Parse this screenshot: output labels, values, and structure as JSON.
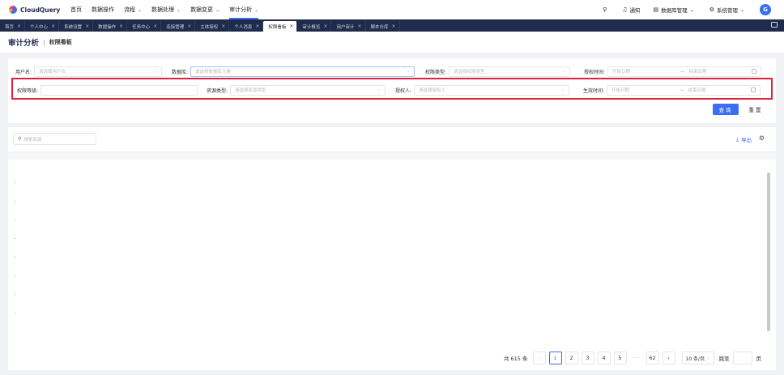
{
  "app": {
    "logo_text": "CloudQuery"
  },
  "nav": [
    {
      "label": "首页",
      "chevron": false,
      "active": false
    },
    {
      "label": "数据操作",
      "chevron": false,
      "active": false
    },
    {
      "label": "流程",
      "chevron": true,
      "active": false
    },
    {
      "label": "数据处理",
      "chevron": true,
      "active": false
    },
    {
      "label": "数据变更",
      "chevron": true,
      "active": false
    },
    {
      "label": "审计分析",
      "chevron": true,
      "active": true
    }
  ],
  "top_right": {
    "search_icon": "search-icon",
    "notify_label": "通知",
    "db_manage_label": "数据库管理",
    "sys_manage_label": "系统管理",
    "avatar_letter": "G"
  },
  "tabs": [
    {
      "label": "首页",
      "active": false
    },
    {
      "label": "个人中心",
      "active": false
    },
    {
      "label": "系统设置",
      "active": false
    },
    {
      "label": "数据操作",
      "active": false
    },
    {
      "label": "任务中心",
      "active": false
    },
    {
      "label": "连接管理",
      "active": false
    },
    {
      "label": "主体授权",
      "active": false
    },
    {
      "label": "个人消息",
      "active": false
    },
    {
      "label": "权限看板",
      "active": true
    },
    {
      "label": "审计概览",
      "active": false
    },
    {
      "label": "用户审计",
      "active": false
    },
    {
      "label": "脚本仓库",
      "active": false
    }
  ],
  "page": {
    "title": "审计分析",
    "subtitle": "权限看板"
  },
  "filters": {
    "row1": {
      "user_label": "用户名:",
      "user_placeholder": "请选择用户名",
      "db_label": "数据库:",
      "db_placeholder": "请选择数据库元素",
      "perm_type_label": "权限类型:",
      "perm_type_placeholder": "请选择权限类型",
      "grant_time_label": "授权时间:",
      "start_placeholder": "开始日期",
      "end_placeholder": "结束日期"
    },
    "row2": {
      "level_label": "权限等级:",
      "level_value": "",
      "res_type_label": "资源类型:",
      "res_type_placeholder": "请选择资源类型",
      "grantor_label": "授权人:",
      "grantor_placeholder": "请选择授权人",
      "effect_time_label": "生效时间:",
      "start_placeholder": "开始日期",
      "end_placeholder": "结束日期"
    },
    "query_label": "查询",
    "reset_label": "重置"
  },
  "table": {
    "search_placeholder": "搜索资源",
    "export_label": "导出"
  },
  "pagination": {
    "total_label": "共 615 条",
    "pages": [
      "1",
      "2",
      "3",
      "4",
      "5"
    ],
    "ellipsis": "···",
    "last_page": "62",
    "current": "1",
    "page_size_label": "10 条/页",
    "goto_label": "跳至",
    "page_unit": "页"
  },
  "colors": {
    "accent": "#3b6ef5",
    "highlight": "#e0213a",
    "tabbar": "#1e2b4a"
  }
}
